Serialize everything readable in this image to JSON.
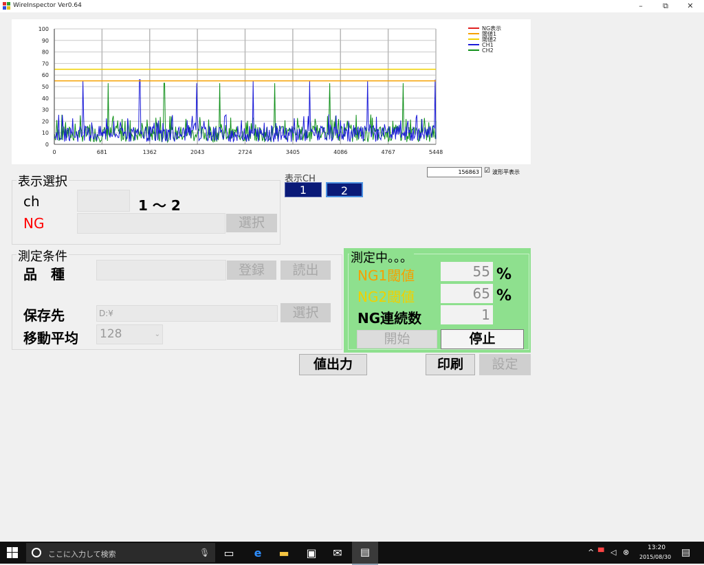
{
  "window": {
    "title": "WireInspector Ver0.64",
    "min": "–",
    "max": "⧉",
    "close": "✕"
  },
  "chart_data": {
    "type": "line",
    "x_ticks": [
      "0",
      "681",
      "1362",
      "2043",
      "2724",
      "3405",
      "4086",
      "4767",
      "5448"
    ],
    "y_ticks": [
      "100",
      "90",
      "80",
      "70",
      "60",
      "50",
      "40",
      "30",
      "20",
      "10",
      "0"
    ],
    "ylim": [
      0,
      100
    ],
    "xlim": [
      0,
      5448
    ],
    "legend_position": "right",
    "series": [
      {
        "name": "NG表示",
        "color": "#e02020"
      },
      {
        "name": "閾値1",
        "color": "#f5a000",
        "values_const": 55
      },
      {
        "name": "閾値2",
        "color": "#f0d000",
        "values_const": 65
      },
      {
        "name": "CH1",
        "color": "#1a1ad8",
        "peaks": [
          {
            "x": 410,
            "y": 55
          },
          {
            "x": 1220,
            "y": 56
          },
          {
            "x": 2035,
            "y": 53
          },
          {
            "x": 2840,
            "y": 55
          },
          {
            "x": 3650,
            "y": 55
          },
          {
            "x": 4470,
            "y": 55
          },
          {
            "x": 5440,
            "y": 56
          }
        ]
      },
      {
        "name": "CH2",
        "color": "#10901a",
        "peaks": [
          {
            "x": 770,
            "y": 53
          },
          {
            "x": 1570,
            "y": 53
          },
          {
            "x": 2360,
            "y": 53
          },
          {
            "x": 3150,
            "y": 53
          },
          {
            "x": 3930,
            "y": 53
          },
          {
            "x": 4980,
            "y": 53
          }
        ]
      }
    ]
  },
  "chart_controls": {
    "value": "156863",
    "checkbox_label": "波形平表示",
    "checked": "☑"
  },
  "display_select": {
    "title": "表示選択",
    "ch_label": "ch",
    "ch_range": "1 ～ 2",
    "ng_label": "NG",
    "select_button": "選択"
  },
  "display_ch": {
    "label": "表示CH",
    "buttons": [
      "1",
      "2"
    ]
  },
  "measure_conditions": {
    "title": "測定条件",
    "product_label": "品　種",
    "register_button": "登録",
    "load_button": "読出",
    "save_label": "保存先",
    "save_value": "D:¥",
    "save_select_button": "選択",
    "moving_avg_label": "移動平均",
    "moving_avg_value": "128"
  },
  "measuring": {
    "title": "測定中。。。",
    "ng1_label": "NG1閾値",
    "ng1_value": "55",
    "ng1_unit": "%",
    "ng2_label": "NG2閾値",
    "ng2_value": "65",
    "ng2_unit": "%",
    "consec_label": "NG連続数",
    "consec_value": "1",
    "start_button": "開始",
    "stop_button": "停止",
    "colors": {
      "ng1": "#f5a000",
      "ng2": "#f0d000",
      "panel": "#8ee08e"
    }
  },
  "bottom_buttons": {
    "output": "値出力",
    "print": "印刷",
    "settings": "設定"
  },
  "taskbar": {
    "search_placeholder": "ここに入力して検索",
    "time": "13:20",
    "date": "2015/08/30"
  }
}
